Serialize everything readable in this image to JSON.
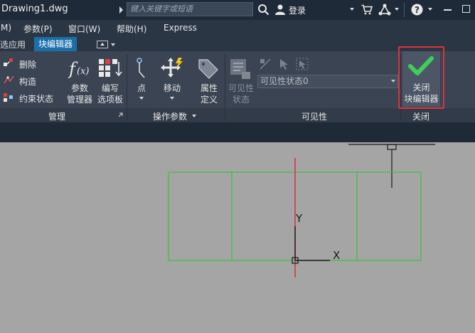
{
  "titlebar": {
    "title": "Drawing1.dwg",
    "search_placeholder": "键入关键字或短语",
    "login": "登录",
    "icons": [
      "search-icon",
      "user-icon",
      "cart-icon",
      "share-icon",
      "help-icon",
      "minimize-icon",
      "maximize-icon"
    ]
  },
  "menubar": {
    "items": [
      "M)",
      "参数(P)",
      "窗口(W)",
      "帮助(H)",
      "Express"
    ]
  },
  "tabs": {
    "items": [
      "选应用",
      "块编辑器"
    ],
    "active": "块编辑器"
  },
  "ribbon": {
    "manage": {
      "title": "管理",
      "small": [
        "删除",
        "构造",
        "约束状态"
      ],
      "param_manager": [
        "参数",
        "管理器"
      ],
      "write_palette": [
        "编写",
        "选项板"
      ]
    },
    "params": {
      "title": "操作参数",
      "point": "点",
      "move": "移动",
      "attr_def": [
        "属性",
        "定义"
      ]
    },
    "visibility": {
      "title": "可见性",
      "vis_state": [
        "可见性",
        "状态"
      ],
      "select_value": "可见性状态0"
    },
    "close": {
      "title": "关闭",
      "button": [
        "关闭",
        "块编辑器"
      ]
    }
  },
  "canvas": {
    "y_axis_label": "Y",
    "x_axis_label": "X",
    "colors": {
      "background": "#a5a5a5",
      "rectangle": "#3ec23a",
      "y_axis": "#e0252b",
      "lines": "#1a1a1a"
    }
  }
}
